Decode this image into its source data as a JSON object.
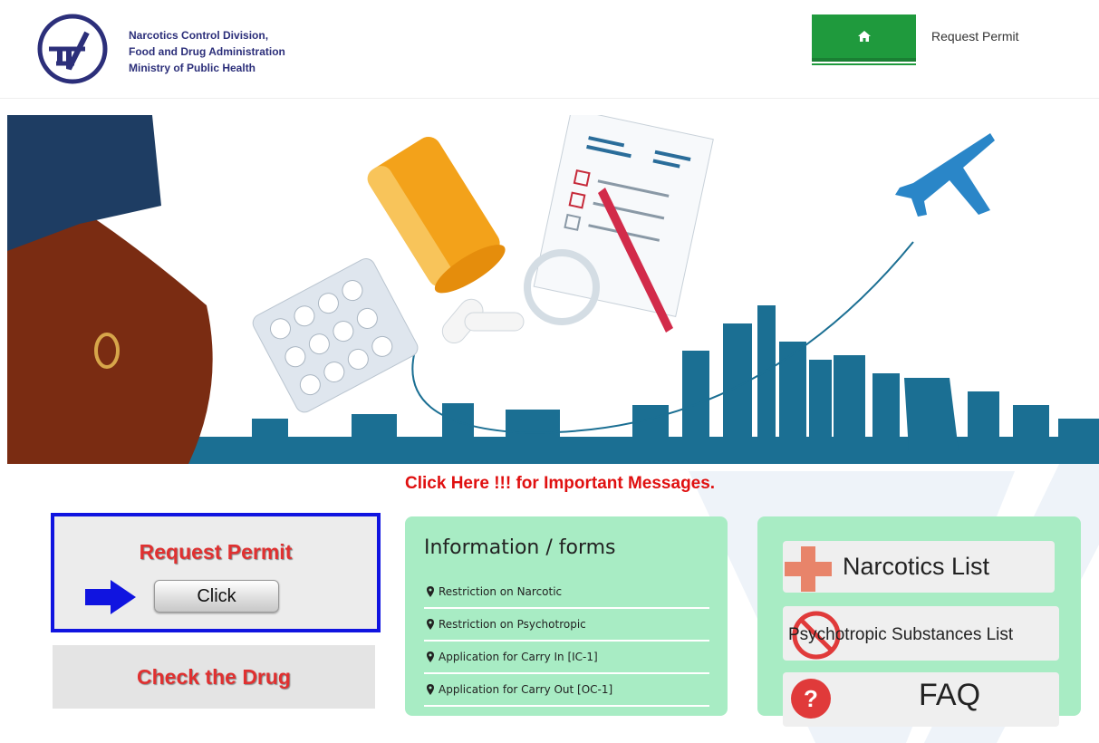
{
  "header": {
    "org_lines": [
      "Narcotics Control Division,",
      "Food and Drug Administration",
      "Ministry of Public Health"
    ],
    "home_icon": "home-icon",
    "nav_link": "Request Permit",
    "accent": "#1f9a3d"
  },
  "banner": {
    "description_icon": "travel-medication-banner"
  },
  "important_message": "Click Here !!! for Important Messages.",
  "request_box": {
    "title": "Request Permit",
    "button": "Click",
    "arrow_icon": "arrow-right-icon",
    "border_color": "#1014e0"
  },
  "check_box": {
    "title": "Check the Drug"
  },
  "info": {
    "title": "Information / forms",
    "items": [
      "Restriction on Narcotic",
      "Restriction on Psychotropic",
      "Application for Carry In [IC-1]",
      "Application for Carry Out [OC-1]"
    ],
    "bg": "#a8ecc4"
  },
  "side": {
    "tiles": [
      {
        "label": "Narcotics List",
        "icon": "plus-icon"
      },
      {
        "label": "Psychotropic Substances List",
        "icon": "prohibited-icon"
      },
      {
        "label": "FAQ",
        "icon": "question-icon"
      }
    ]
  }
}
